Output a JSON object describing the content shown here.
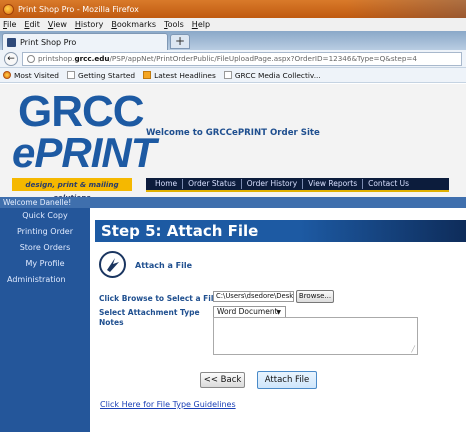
{
  "browser": {
    "window_title": "Print Shop Pro - Mozilla Firefox",
    "menu": [
      "File",
      "Edit",
      "View",
      "History",
      "Bookmarks",
      "Tools",
      "Help"
    ],
    "tab_title": "Print Shop Pro",
    "new_tab": "+",
    "url_prefix": "printshop.",
    "url_domain": "grcc.edu",
    "url_path": "/PSP/appNet/PrintOrderPublic/FileUploadPage.aspx?OrderID=12346&Type=Q&step=4",
    "bookmarks": [
      "Most Visited",
      "Getting Started",
      "Latest Headlines",
      "GRCC Media Collectiv..."
    ]
  },
  "header": {
    "logo_top": "GRCC",
    "logo_bottom": "ePRINT",
    "logo_tagline": "design, print & mailing solutions",
    "welcome": "Welcome to GRCCePRINT Order Site",
    "nav": [
      "Home",
      "Order Status",
      "Order History",
      "View Reports",
      "Contact Us"
    ]
  },
  "user_bar": "Welcome Danelle!",
  "sidebar": [
    "Quick Copy",
    "Printing Order",
    "Store Orders",
    "My Profile",
    "Administration"
  ],
  "main": {
    "step_title": "Step 5: Attach File",
    "section_title": "Attach a File",
    "browse_label": "Click Browse to Select a File",
    "file_value": "C:\\Users\\dsedore\\Deskt",
    "browse_button": "Browse...",
    "attachment_type_label": "Select Attachment Type",
    "attachment_type_value": "Word Document",
    "notes_label": "Notes",
    "back_button": "<< Back",
    "attach_button": "Attach File",
    "guidelines_link": "Click Here for File Type Guidelines"
  },
  "colors": {
    "brand_blue": "#1d5aa3",
    "nav_dark": "#0c1c3c",
    "gold": "#f5b800",
    "sidebar": "#24569a"
  }
}
